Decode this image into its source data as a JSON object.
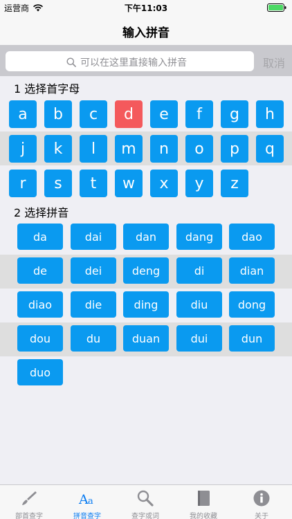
{
  "status": {
    "carrier": "运营商",
    "time": "下午11:03"
  },
  "nav": {
    "title": "输入拼音"
  },
  "search": {
    "placeholder": "可以在这里直接输入拼音",
    "cancel": "取消"
  },
  "sections": {
    "letters": "1 选择首字母",
    "pinyin": "2 选择拼音"
  },
  "letters": [
    "a",
    "b",
    "c",
    "d",
    "e",
    "f",
    "g",
    "h",
    "j",
    "k",
    "l",
    "m",
    "n",
    "o",
    "p",
    "q",
    "r",
    "s",
    "t",
    "w",
    "x",
    "y",
    "z"
  ],
  "selected_letter": "d",
  "pinyin": [
    "da",
    "dai",
    "dan",
    "dang",
    "dao",
    "de",
    "dei",
    "deng",
    "di",
    "dian",
    "diao",
    "die",
    "ding",
    "diu",
    "dong",
    "dou",
    "du",
    "duan",
    "dui",
    "dun",
    "duo"
  ],
  "tabs": [
    {
      "label": "部首查字",
      "icon": "brush-icon",
      "active": false
    },
    {
      "label": "拼音查字",
      "icon": "font-aa-icon",
      "active": true
    },
    {
      "label": "查字或词",
      "icon": "magnifier-icon",
      "active": false
    },
    {
      "label": "我的收藏",
      "icon": "book-icon",
      "active": false
    },
    {
      "label": "关于",
      "icon": "info-icon",
      "active": false
    }
  ],
  "colors": {
    "button": "#0a9af0",
    "selected": "#f4595c",
    "active_tab": "#0a7cf2"
  }
}
